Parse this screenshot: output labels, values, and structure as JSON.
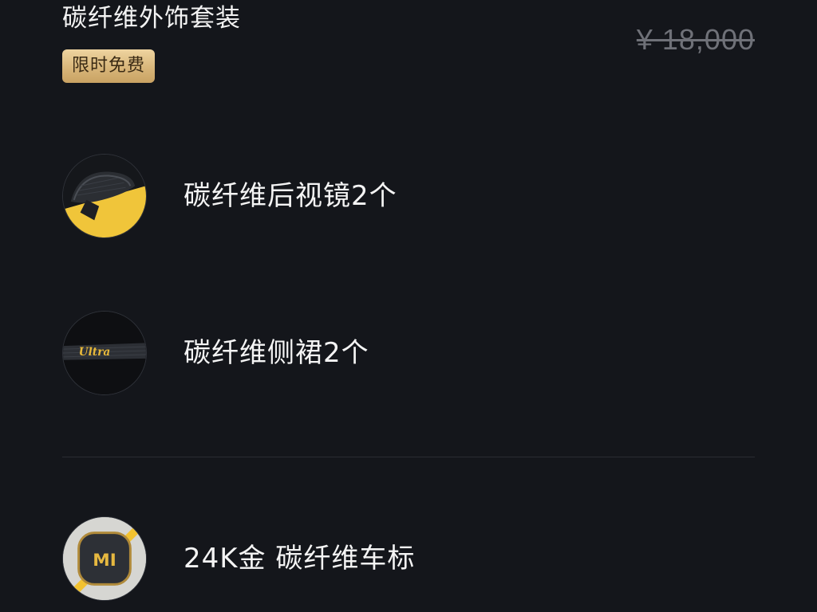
{
  "package": {
    "title": "碳纤维外饰套装",
    "badge": "限时免费",
    "original_price": "¥ 18,000"
  },
  "items": [
    {
      "label": "碳纤维后视镜2个",
      "icon": "mirror-thumbnail"
    },
    {
      "label": "碳纤维侧裙2个",
      "icon": "side-skirt-thumbnail",
      "thumb_text": "Ultra"
    },
    {
      "label": "24K金 碳纤维车标",
      "icon": "logo-badge-thumbnail",
      "thumb_text": "MI"
    }
  ],
  "colors": {
    "background": "#14161b",
    "badge_gold": "#d8b67a",
    "accent_yellow": "#f2c230",
    "muted_price": "#6f7178"
  }
}
